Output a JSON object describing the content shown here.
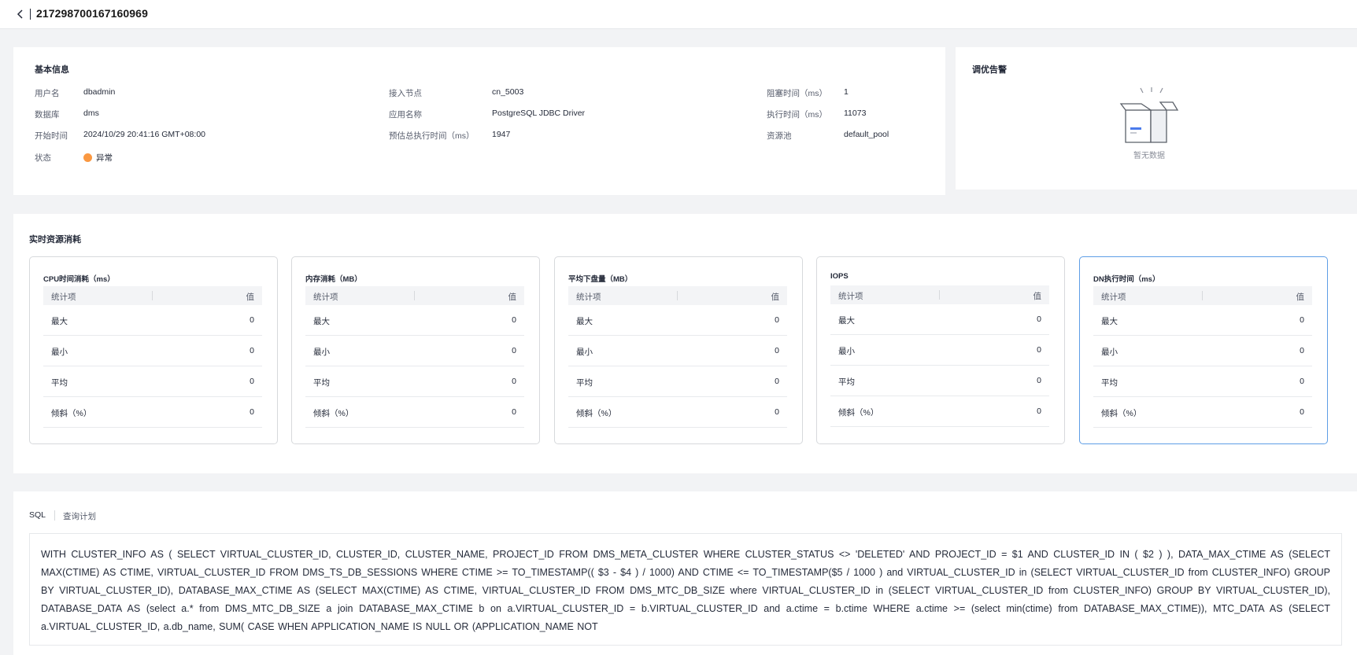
{
  "header": {
    "title": "217298700167160969",
    "back_icon": "chevron-left-icon"
  },
  "basic_info": {
    "title": "基本信息",
    "fields": [
      {
        "label": "用户名",
        "value": "dbadmin"
      },
      {
        "label": "数据库",
        "value": "dms"
      },
      {
        "label": "开始时间",
        "value": "2024/10/29 20:41:16 GMT+08:00"
      },
      {
        "label": "状态",
        "value": "异常"
      },
      {
        "label": "接入节点",
        "value": "cn_5003"
      },
      {
        "label": "应用名称",
        "value": "PostgreSQL JDBC Driver"
      },
      {
        "label": "预估总执行时间（ms）",
        "value": "1947"
      },
      {
        "label": "阻塞时间（ms）",
        "value": "1"
      },
      {
        "label": "执行时间（ms）",
        "value": "11073"
      },
      {
        "label": "资源池",
        "value": "default_pool"
      }
    ],
    "status_color": "#fa9841"
  },
  "tuning_alert": {
    "title": "调优告警",
    "empty_text": "暂无数据",
    "empty_icon": "empty-box-icon"
  },
  "realtime": {
    "title": "实时资源消耗",
    "header_item": "统计项",
    "header_value": "值",
    "metrics": [
      {
        "title": "CPU时间消耗（ms）",
        "rows": [
          {
            "label": "最大",
            "value": "0"
          },
          {
            "label": "最小",
            "value": "0"
          },
          {
            "label": "平均",
            "value": "0"
          },
          {
            "label": "倾斜（%）",
            "value": "0"
          }
        ]
      },
      {
        "title": "内存消耗（MB）",
        "rows": [
          {
            "label": "最大",
            "value": "0"
          },
          {
            "label": "最小",
            "value": "0"
          },
          {
            "label": "平均",
            "value": "0"
          },
          {
            "label": "倾斜（%）",
            "value": "0"
          }
        ]
      },
      {
        "title": "平均下盘量（MB）",
        "rows": [
          {
            "label": "最大",
            "value": "0"
          },
          {
            "label": "最小",
            "value": "0"
          },
          {
            "label": "平均",
            "value": "0"
          },
          {
            "label": "倾斜（%）",
            "value": "0"
          }
        ]
      },
      {
        "title": "IOPS",
        "rows": [
          {
            "label": "最大",
            "value": "0"
          },
          {
            "label": "最小",
            "value": "0"
          },
          {
            "label": "平均",
            "value": "0"
          },
          {
            "label": "倾斜（%）",
            "value": "0"
          }
        ]
      },
      {
        "title": "DN执行时间（ms）",
        "rows": [
          {
            "label": "最大",
            "value": "0"
          },
          {
            "label": "最小",
            "value": "0"
          },
          {
            "label": "平均",
            "value": "0"
          },
          {
            "label": "倾斜（%）",
            "value": "0"
          }
        ]
      }
    ]
  },
  "sql_section": {
    "tabs": [
      "SQL",
      "查询计划"
    ],
    "active_tab": "SQL",
    "sql_text": "WITH CLUSTER_INFO AS ( SELECT VIRTUAL_CLUSTER_ID, CLUSTER_ID, CLUSTER_NAME, PROJECT_ID FROM DMS_META_CLUSTER WHERE CLUSTER_STATUS <> 'DELETED' AND PROJECT_ID = $1 AND CLUSTER_ID IN ( $2 ) ), DATA_MAX_CTIME AS (SELECT MAX(CTIME) AS CTIME, VIRTUAL_CLUSTER_ID FROM DMS_TS_DB_SESSIONS WHERE CTIME >= TO_TIMESTAMP(( $3 - $4 ) / 1000) AND CTIME <= TO_TIMESTAMP($5 / 1000 ) and VIRTUAL_CLUSTER_ID in (SELECT VIRTUAL_CLUSTER_ID from CLUSTER_INFO) GROUP BY VIRTUAL_CLUSTER_ID), DATABASE_MAX_CTIME AS (SELECT MAX(CTIME) AS CTIME, VIRTUAL_CLUSTER_ID FROM DMS_MTC_DB_SIZE where VIRTUAL_CLUSTER_ID in (SELECT VIRTUAL_CLUSTER_ID from CLUSTER_INFO) GROUP BY VIRTUAL_CLUSTER_ID), DATABASE_DATA AS (select a.* from DMS_MTC_DB_SIZE a join DATABASE_MAX_CTIME b on a.VIRTUAL_CLUSTER_ID = b.VIRTUAL_CLUSTER_ID and a.ctime = b.ctime WHERE a.ctime >= (select min(ctime) from DATABASE_MAX_CTIME)), MTC_DATA AS (SELECT a.VIRTUAL_CLUSTER_ID, a.db_name, SUM( CASE WHEN APPLICATION_NAME IS NULL OR (APPLICATION_NAME NOT"
  }
}
